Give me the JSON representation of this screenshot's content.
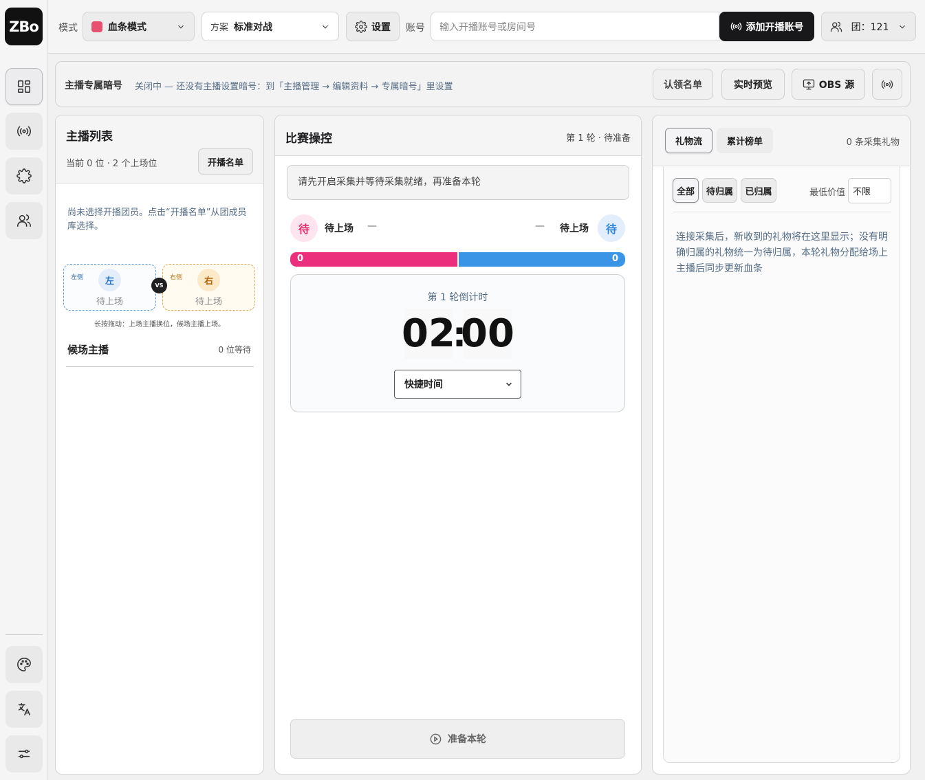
{
  "app": {
    "logo_text": "ZBo"
  },
  "sidebar": {
    "nav": [
      "dashboard",
      "broadcast",
      "plugins",
      "users"
    ],
    "bottom": [
      "theme",
      "language",
      "settings"
    ]
  },
  "topbar": {
    "mode_label": "模式",
    "mode_value": "血条模式",
    "mode_color": "#e8506f",
    "plan_label": "方案",
    "plan_value": "标准对战",
    "settings_button": "设置",
    "account_label": "账号",
    "account_placeholder": "输入开播账号或房间号",
    "add_account_button": "添加开播账号",
    "team_label": "团：121"
  },
  "secret": {
    "title": "主播专属暗号",
    "description": "关闭中 — 还没有主播设置暗号：到「主播管理 → 编辑资料 → 专属暗号」里设置",
    "claim_list": "认领名单",
    "live_preview": "实时预览",
    "obs_source": "OBS 源"
  },
  "host_panel": {
    "title": "主播列表",
    "subtitle": "当前 0 位 · 2 个上场位",
    "roster_button": "开播名单",
    "empty_hint": "尚未选择开播团员。点击“开播名单”从团成员库选择。",
    "left_slot": {
      "tag": "左侧",
      "badge": "左",
      "status": "待上场"
    },
    "right_slot": {
      "tag": "右侧",
      "badge": "右",
      "status": "待上场"
    },
    "vs": "VS",
    "drag_hint": "长按拖动：上场主播换位，候场主播上场。",
    "waiting_title": "候场主播",
    "waiting_count": "0 位等待"
  },
  "match_panel": {
    "title": "比赛操控",
    "round_status": "第 1 轮 · 待准备",
    "notice": "请先开启采集并等待采集就绪，再准备本轮",
    "left": {
      "badge": "待",
      "name": "待上场",
      "dash": "—",
      "score": "0"
    },
    "right": {
      "badge": "待",
      "name": "待上场",
      "dash": "—",
      "score": "0"
    },
    "left_share": 0.5,
    "countdown_label": "第 1 轮倒计时",
    "minutes": "02",
    "seconds": "00",
    "colon": ":",
    "quick_time": "快捷时间",
    "prepare_button": "准备本轮"
  },
  "gift_panel": {
    "tab_flow": "礼物流",
    "tab_rank": "累计榜单",
    "count": "0 条采集礼物",
    "filter_all": "全部",
    "filter_pending": "待归属",
    "filter_assigned": "已归属",
    "min_value_label": "最低价值",
    "min_value": "不限",
    "empty_text": "连接采集后，新收到的礼物将在这里显示；没有明确归属的礼物统一为待归属，本轮礼物分配给场上主播后同步更新血条"
  }
}
